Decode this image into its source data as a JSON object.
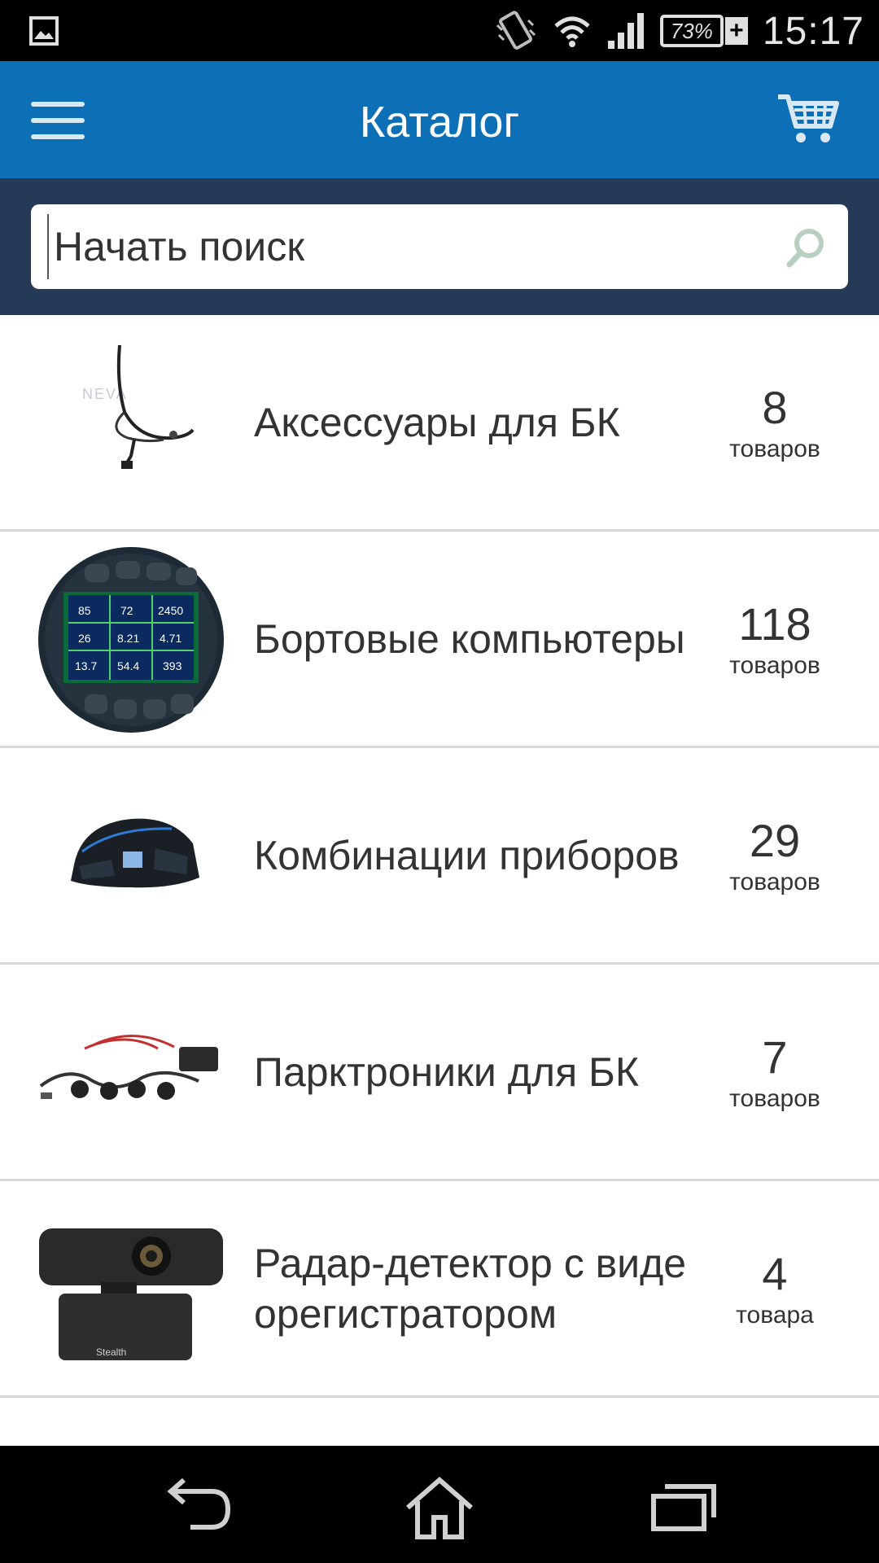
{
  "status_bar": {
    "battery": "73%",
    "battery_plus": "+",
    "time": "15:17",
    "icons": [
      "gallery-icon",
      "vibrate-icon",
      "wifi-icon",
      "signal-icon",
      "battery-icon"
    ]
  },
  "app_bar": {
    "title": "Каталог",
    "menu_icon": "menu-icon",
    "cart_icon": "cart-icon",
    "accent_color": "#0d70b7"
  },
  "search": {
    "placeholder": "Начать поиск",
    "value": "",
    "icon": "search-icon"
  },
  "categories": [
    {
      "name": "Аксессуары для БК",
      "count": "8",
      "unit": "товаров",
      "image": "headset-cable"
    },
    {
      "name": "Бортовые компьютеры",
      "count": "118",
      "unit": "товаров",
      "image": "round-onboard-computer"
    },
    {
      "name": "Комбинации приборов",
      "count": "29",
      "unit": "товаров",
      "image": "instrument-cluster"
    },
    {
      "name": "Парктроники для БК",
      "count": "7",
      "unit": "товаров",
      "image": "parking-sensors"
    },
    {
      "name": "Радар-детектор с видеорегистратором",
      "count": "4",
      "unit": "товара",
      "image": "radar-dashcam"
    }
  ],
  "nav_bar": {
    "icons": [
      "back-icon",
      "home-icon",
      "recent-apps-icon"
    ]
  }
}
